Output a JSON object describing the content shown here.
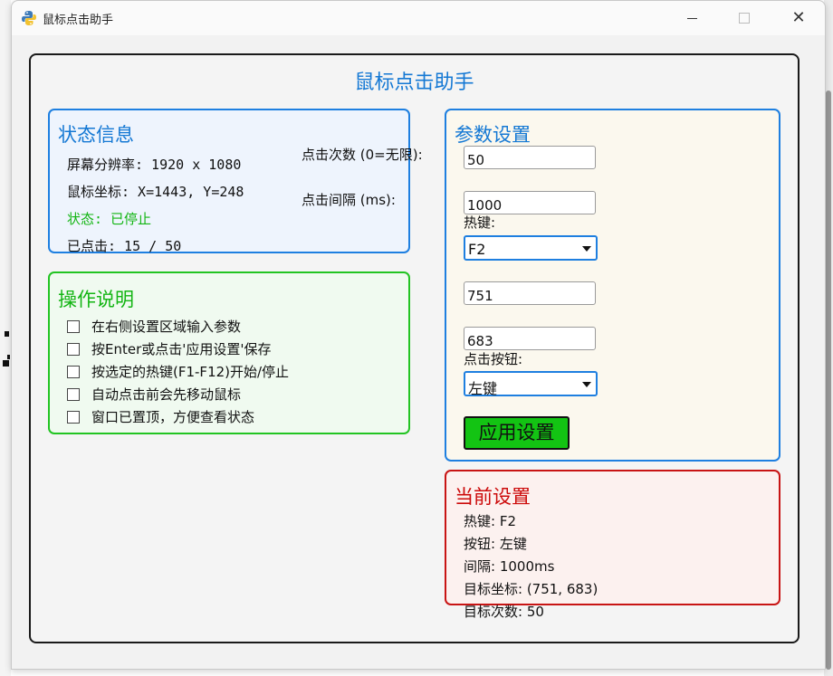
{
  "window": {
    "title": "鼠标点击助手",
    "close_glyph": "✕"
  },
  "main": {
    "heading": "鼠标点击助手"
  },
  "status": {
    "title": "状态信息",
    "resolution": "屏幕分辨率: 1920 x 1080",
    "mouse_pos": "鼠标坐标: X=1443, Y=248",
    "state": "状态: 已停止",
    "clicked": "已点击: 15 / 50",
    "state_color": "#13b513"
  },
  "side_labels": {
    "click_count": "点击次数 (0=无限):",
    "click_interval": "点击间隔 (ms):"
  },
  "instructions": {
    "title": "操作说明",
    "items": [
      "在右侧设置区域输入参数",
      "按Enter或点击'应用设置'保存",
      "按选定的热键(F1-F12)开始/停止",
      "自动点击前会先移动鼠标",
      "窗口已置顶，方便查看状态"
    ]
  },
  "params": {
    "title": "参数设置",
    "click_count_value": "50",
    "interval_value": "1000",
    "hotkey_label": "热键:",
    "hotkey_value": "F2",
    "x_value": "751",
    "y_value": "683",
    "button_label": "点击按钮:",
    "button_value": "左键",
    "apply_label": "应用设置"
  },
  "current": {
    "title": "当前设置",
    "hotkey": "热键: F2",
    "button": "按钮: 左键",
    "interval": "间隔: 1000ms",
    "target": "目标坐标: (751, 683)",
    "count": "目标次数: 50"
  },
  "colors": {
    "accent_blue": "#1478d4",
    "ops_green": "#13b513",
    "current_red": "#cc0a0a",
    "apply_green": "#13c413"
  }
}
